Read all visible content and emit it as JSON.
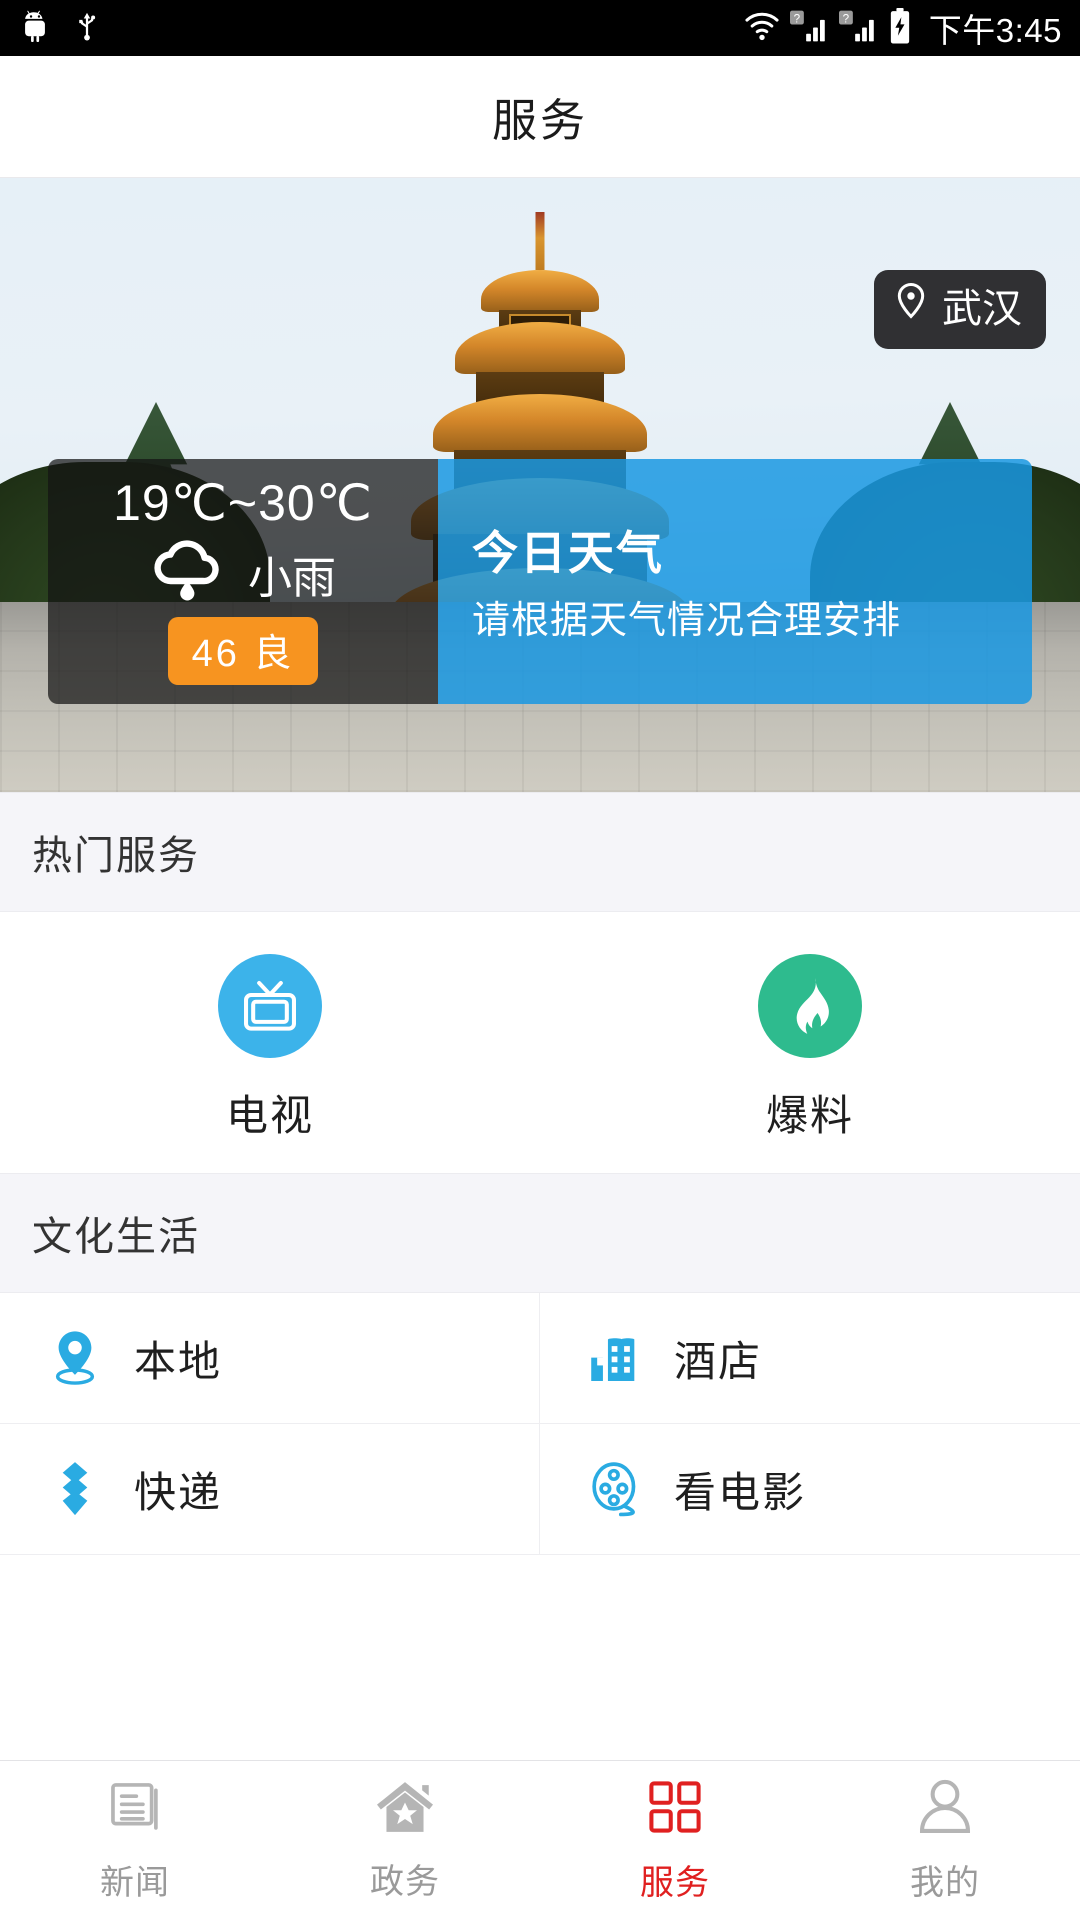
{
  "status_bar": {
    "icons": [
      "android-robot-icon",
      "usb-icon",
      "wifi-icon",
      "signal-sim1-icon",
      "signal-sim2-icon",
      "battery-charging-icon"
    ],
    "time": "下午3:45"
  },
  "header": {
    "title": "服务"
  },
  "hero": {
    "location_badge": {
      "icon": "location-pin-icon",
      "label": "武汉"
    },
    "image_subject": "黄鹤楼"
  },
  "weather": {
    "temperature_range": "19℃~30℃",
    "condition_icon": "rain-cloud-icon",
    "condition": "小雨",
    "aqi_value": "46",
    "aqi_level": "良",
    "aqi_badge": "46 良",
    "aqi_color": "#f79420",
    "panel": {
      "title": "今日天气",
      "description": "请根据天气情况合理安排",
      "color": "#1998e2"
    }
  },
  "hot_services": {
    "section_title": "热门服务",
    "items": [
      {
        "label": "电视",
        "icon": "tv-icon",
        "color": "#3cb3ea"
      },
      {
        "label": "爆料",
        "icon": "flame-icon",
        "color": "#2ebb8e"
      }
    ]
  },
  "culture_life": {
    "section_title": "文化生活",
    "items": [
      {
        "label": "本地",
        "icon": "map-pin-icon",
        "color": "#2aabe2"
      },
      {
        "label": "酒店",
        "icon": "hotel-building-icon",
        "color": "#2aabe2"
      },
      {
        "label": "快递",
        "icon": "express-diamond-icon",
        "color": "#2aabe2"
      },
      {
        "label": "看电影",
        "icon": "film-reel-icon",
        "color": "#2aabe2"
      }
    ]
  },
  "tabbar": {
    "active_color": "#e02020",
    "inactive_color": "#9a9a9a",
    "tabs": [
      {
        "label": "新闻",
        "icon": "news-document-icon",
        "active": false
      },
      {
        "label": "政务",
        "icon": "home-star-icon",
        "active": false
      },
      {
        "label": "服务",
        "icon": "grid-squares-icon",
        "active": true
      },
      {
        "label": "我的",
        "icon": "person-icon",
        "active": false
      }
    ]
  }
}
